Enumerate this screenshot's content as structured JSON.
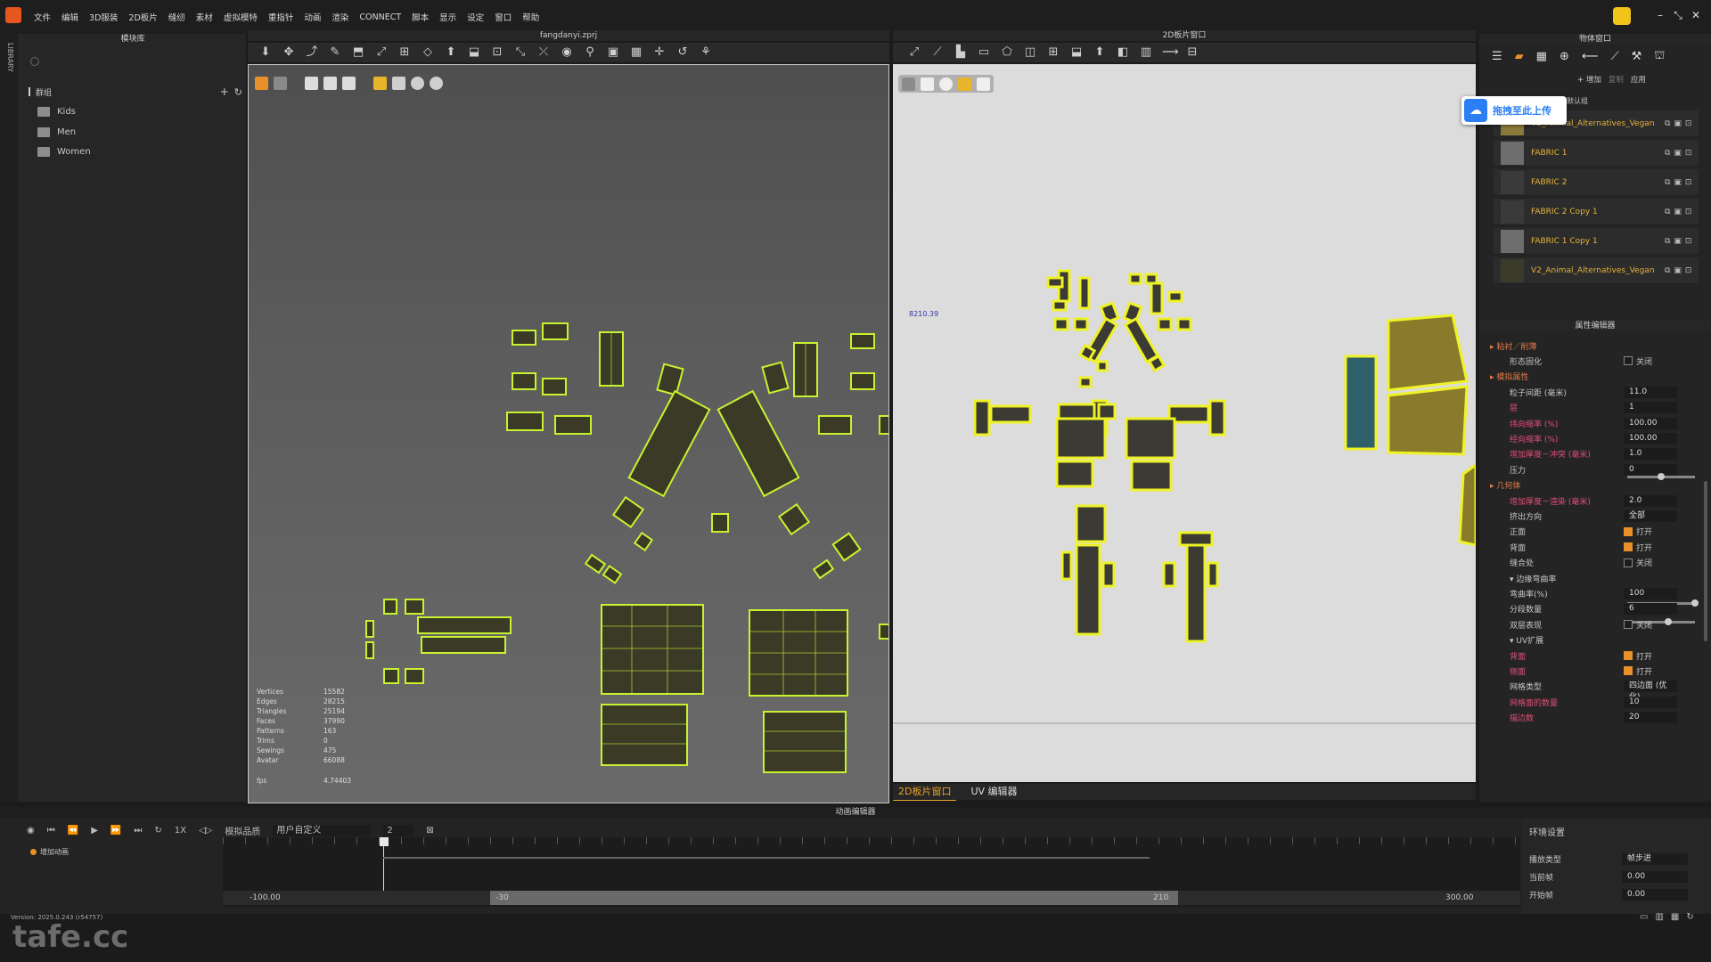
{
  "menubar": {
    "items": [
      "文件",
      "编辑",
      "3D服装",
      "2D板片",
      "缝纫",
      "素材",
      "虚拟模特",
      "重指针",
      "动画",
      "渲染",
      "CONNECT",
      "脚本",
      "显示",
      "设定",
      "窗口",
      "帮助"
    ]
  },
  "left_panel": {
    "title": "模块库",
    "side_tab": "LIBRARY",
    "group_label": "群组",
    "items": [
      "Kids",
      "Men",
      "Women"
    ]
  },
  "viewport3d": {
    "title": "fangdanyi.zprj",
    "stats": [
      {
        "label": "Vertices",
        "value": "15582"
      },
      {
        "label": "Edges",
        "value": "28215"
      },
      {
        "label": "Triangles",
        "value": "25194"
      },
      {
        "label": "Faces",
        "value": "37990"
      },
      {
        "label": "Patterns",
        "value": "163"
      },
      {
        "label": "Trims",
        "value": "0"
      },
      {
        "label": "Sewings",
        "value": "475"
      },
      {
        "label": "Avatar",
        "value": "66088"
      }
    ],
    "fps_label": "fps",
    "fps_value": "4.74403"
  },
  "viewport2d": {
    "title": "2D板片窗口",
    "coord": "8210.39",
    "tabs": [
      "2D板片窗口",
      "UV 编辑器"
    ]
  },
  "right_panel": {
    "title": "物体窗口",
    "add_label": "+ 增加",
    "copy_label": "复制",
    "apply_label": "应用",
    "default_label": "默认组",
    "fabrics": [
      {
        "name": "V2_Animal_Alternatives_Vegan",
        "color": "#8a7a3a"
      },
      {
        "name": "FABRIC 1",
        "color": "#6e6e6e"
      },
      {
        "name": "FABRIC 2",
        "color": "#3a3a3a"
      },
      {
        "name": "FABRIC 2 Copy 1",
        "color": "#3a3a3a"
      },
      {
        "name": "FABRIC 1 Copy 1",
        "color": "#6e6e6e"
      },
      {
        "name": "V2_Animal_Alternatives_Vegan",
        "color": "#3b3b2c"
      }
    ],
    "upload_label": "拖拽至此上传"
  },
  "property_editor": {
    "title": "属性编辑器",
    "rows": [
      {
        "label": "粘衬／削薄",
        "value": "",
        "kind": "section"
      },
      {
        "label": "形态固化",
        "value": "关闭",
        "kind": "check"
      },
      {
        "label": "模拟属性",
        "value": "",
        "kind": "section"
      },
      {
        "label": "粒子间距 (毫米)",
        "value": "11.0",
        "kind": "value"
      },
      {
        "label": "层",
        "value": "1",
        "kind": "pink"
      },
      {
        "label": "纬向缩率 (%)",
        "value": "100.00",
        "kind": "pink"
      },
      {
        "label": "经向缩率 (%)",
        "value": "100.00",
        "kind": "pink"
      },
      {
        "label": "增加厚度－冲突 (毫米)",
        "value": "1.0",
        "kind": "pink"
      },
      {
        "label": "压力",
        "value": "0",
        "kind": "slider"
      },
      {
        "label": "几何体",
        "value": "",
        "kind": "section"
      },
      {
        "label": "增加厚度－渲染 (毫米)",
        "value": "2.0",
        "kind": "pink"
      },
      {
        "label": "挤出方向",
        "value": "全部",
        "kind": "value"
      },
      {
        "label": "正面",
        "value": "打开",
        "kind": "checkon"
      },
      {
        "label": "背面",
        "value": "打开",
        "kind": "checkon"
      },
      {
        "label": "缝合处",
        "value": "关闭",
        "kind": "check"
      },
      {
        "label": "边缘弯曲率",
        "value": "",
        "kind": "sub"
      },
      {
        "label": "弯曲率(%)",
        "value": "100",
        "kind": "slider"
      },
      {
        "label": "分段数量",
        "value": "6",
        "kind": "slider"
      },
      {
        "label": "双层表现",
        "value": "关闭",
        "kind": "check"
      },
      {
        "label": "UV扩展",
        "value": "",
        "kind": "sub"
      },
      {
        "label": "背面",
        "value": "打开",
        "kind": "checkonpink"
      },
      {
        "label": "侧面",
        "value": "打开",
        "kind": "checkonpink"
      },
      {
        "label": "网格类型",
        "value": "四边面 (优化)",
        "kind": "value"
      },
      {
        "label": "网格面的数量",
        "value": "10",
        "kind": "pink"
      },
      {
        "label": "描边数",
        "value": "20",
        "kind": "pink"
      }
    ],
    "slider_levels": {
      "压力": 0.5,
      "弯曲率(%)": 1.0,
      "分段数量": 0.6
    }
  },
  "animation": {
    "title": "动画编辑器",
    "quality_label": "模拟品质",
    "quality_value": "用户自定义",
    "step_value": "2",
    "speed": "1X",
    "track_label": "增加动画",
    "range_start": "-100.00",
    "range_left": "-30",
    "range_right": "210",
    "range_end": "300.00",
    "env_title": "环境设置",
    "env_rows": [
      {
        "label": "播放类型",
        "value": "帧步进"
      },
      {
        "label": "当前帧",
        "value": "0.00"
      },
      {
        "label": "开始帧",
        "value": "0.00"
      }
    ]
  },
  "status": {
    "version": "Version: 2025.0.243 (r54757)",
    "watermark": "tafe.cc"
  }
}
